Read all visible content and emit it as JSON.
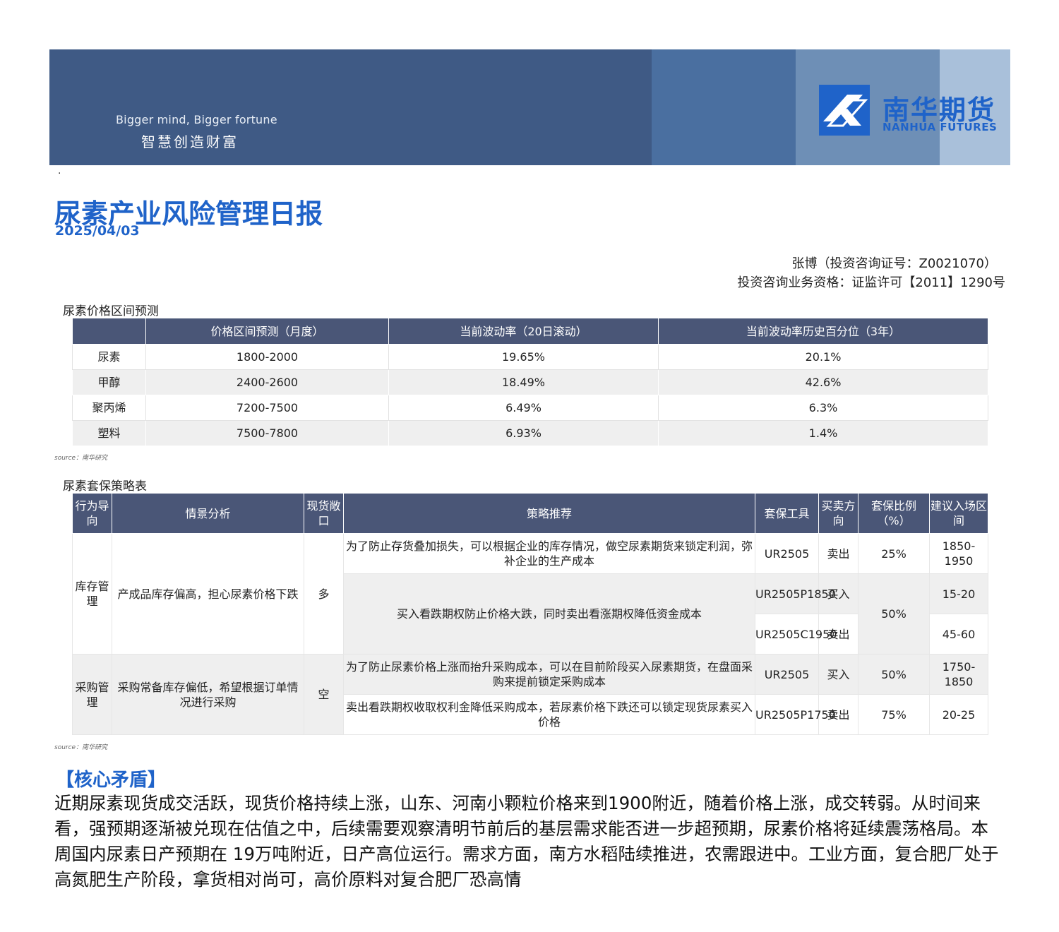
{
  "banner": {
    "slogan_en": "Bigger mind, Bigger fortune",
    "slogan_cn": "智慧创造财富",
    "logo_cn": "南华期货",
    "logo_en": "NANHUA FUTURES",
    "colors": {
      "banner": "#3f5a85",
      "logo": "#1f63c9"
    }
  },
  "dot": "·",
  "report": {
    "title": "尿素产业风险管理日报",
    "date": "2025/04/03",
    "author_line": "张博（投资咨询证号：Z0021070）",
    "license_line": "投资咨询业务资格：证监许可【2011】1290号"
  },
  "table1": {
    "caption": "尿素价格区间预测",
    "headers": [
      "",
      "价格区间预测（月度）",
      "当前波动率（20日滚动）",
      "当前波动率历史百分位（3年）"
    ],
    "rows": [
      [
        "尿素",
        "1800-2000",
        "19.65%",
        "20.1%"
      ],
      [
        "甲醇",
        "2400-2600",
        "18.49%",
        "42.6%"
      ],
      [
        "聚丙烯",
        "7200-7500",
        "6.49%",
        "6.3%"
      ],
      [
        "塑料",
        "7500-7800",
        "6.93%",
        "1.4%"
      ]
    ],
    "source": "source：南华研究"
  },
  "table2": {
    "caption": "尿素套保策略表",
    "headers": [
      "行为导向",
      "情景分析",
      "现货敞口",
      "策略推荐",
      "套保工具",
      "买卖方向",
      "套保比例（%）",
      "建议入场区间"
    ],
    "groups": [
      {
        "orientation": "库存管理",
        "scenario": "产成品库存偏高，担心尿素价格下跌",
        "exposure": "多",
        "strategy1": "为了防止存货叠加损失，可以根据企业的库存情况，做空尿素期货来锁定利润，弥补企业的生产成本",
        "tool1": "UR2505",
        "dir1": "卖出",
        "ratio1": "25%",
        "range1": "1850-1950",
        "strategy2": "买入看跌期权防止价格大跌，同时卖出看涨期权降低资金成本",
        "tool2": "UR2505P1850",
        "dir2": "买入",
        "range2": "15-20",
        "ratio2": "50%",
        "tool3": "UR2505C1950",
        "dir3": "卖出",
        "range3": "45-60"
      },
      {
        "orientation": "采购管理",
        "scenario": "采购常备库存偏低，希望根据订单情况进行采购",
        "exposure": "空",
        "strategy1": "为了防止尿素价格上涨而抬升采购成本，可以在目前阶段买入尿素期货，在盘面采购来提前锁定采购成本",
        "tool1": "UR2505",
        "dir1": "买入",
        "ratio1": "50%",
        "range1": "1750-1850",
        "strategy2": "卖出看跌期权收取权利金降低采购成本，若尿素价格下跌还可以锁定现货尿素买入价格",
        "tool2": "UR2505P1750",
        "dir2": "卖出",
        "ratio2": "75%",
        "range2": "20-25"
      }
    ],
    "source": "source：南华研究"
  },
  "core": {
    "title": "【核心矛盾】",
    "text": "近期尿素现货成交活跃，现货价格持续上涨，山东、河南小颗粒价格来到1900附近，随着价格上涨，成交转弱。从时间来看，强预期逐渐被兑现在估值之中，后续需要观察清明节前后的基层需求能否进一步超预期，尿素价格将延续震荡格局。本周国内尿素日产预期在 19万吨附近，日产高位运行。需求方面，南方水稻陆续推进，农需跟进中。工业方面，复合肥厂处于高氮肥生产阶段，拿货相对尚可，高价原料对复合肥厂恐高情"
  }
}
